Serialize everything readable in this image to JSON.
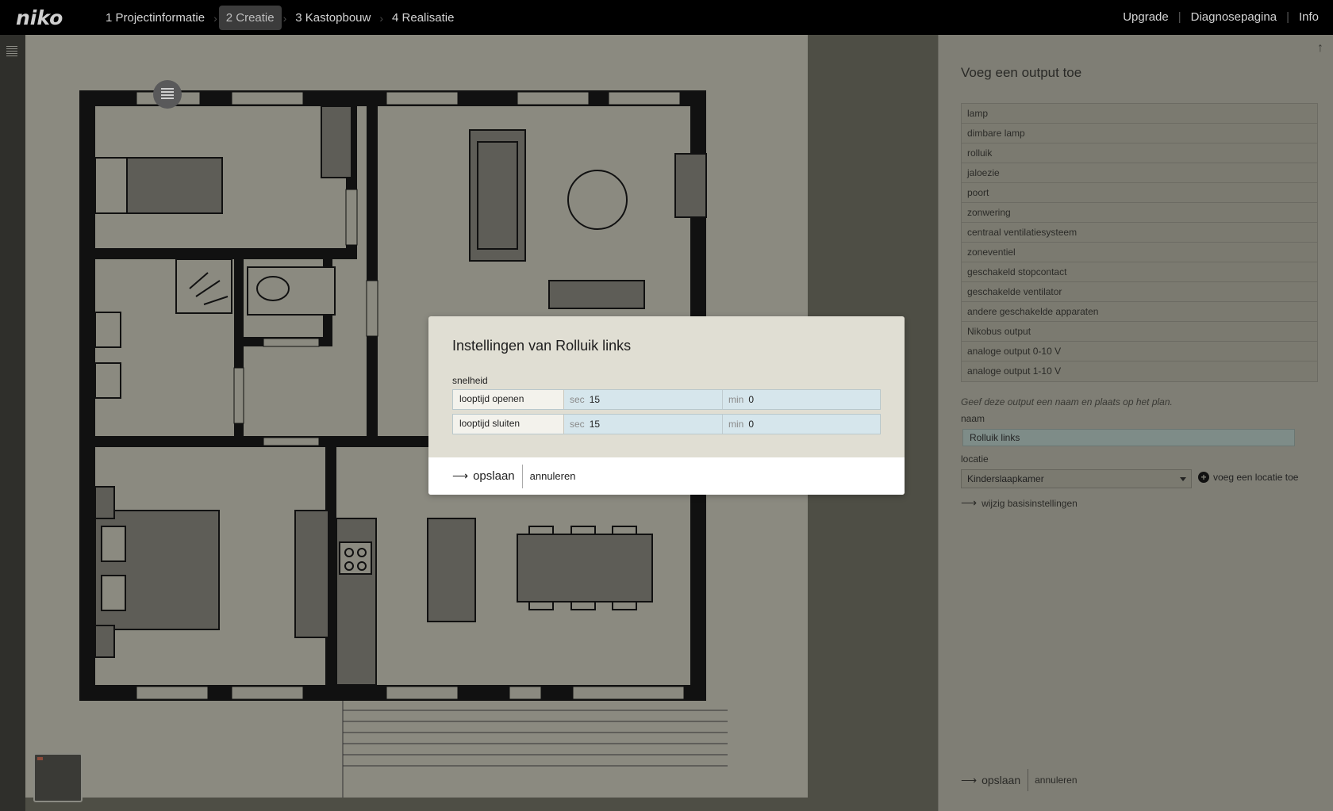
{
  "app": {
    "logo": "niko"
  },
  "steps": [
    {
      "label": "1 Projectinformatie"
    },
    {
      "label": "2 Creatie",
      "active": true
    },
    {
      "label": "3 Kastopbouw"
    },
    {
      "label": "4 Realisatie"
    }
  ],
  "toplinks": {
    "upgrade": "Upgrade",
    "diagnose": "Diagnosepagina",
    "info": "Info"
  },
  "panel": {
    "title": "Voeg een output toe",
    "outputs": [
      "lamp",
      "dimbare lamp",
      "rolluik",
      "jaloezie",
      "poort",
      "zonwering",
      "centraal ventilatiesysteem",
      "zoneventiel",
      "geschakeld stopcontact",
      "geschakelde ventilator",
      "andere geschakelde apparaten",
      "Nikobus output",
      "analoge output 0-10 V",
      "analoge output 1-10 V"
    ],
    "hint": "Geef deze output een naam en plaats op het plan.",
    "name_label": "naam",
    "name_value": "Rolluik links",
    "location_label": "locatie",
    "location_value": "Kinderslaapkamer",
    "add_location": "voeg een locatie toe",
    "base_settings": "wijzig basisinstellingen",
    "save": "opslaan",
    "cancel": "annuleren"
  },
  "modal": {
    "title": "Instellingen van Rolluik links",
    "section": "snelheid",
    "rows": [
      {
        "label": "looptijd openen",
        "sec_unit": "sec",
        "sec": "15",
        "min_unit": "min",
        "min": "0"
      },
      {
        "label": "looptijd sluiten",
        "sec_unit": "sec",
        "sec": "15",
        "min_unit": "min",
        "min": "0"
      }
    ],
    "save": "opslaan",
    "cancel": "annuleren"
  }
}
